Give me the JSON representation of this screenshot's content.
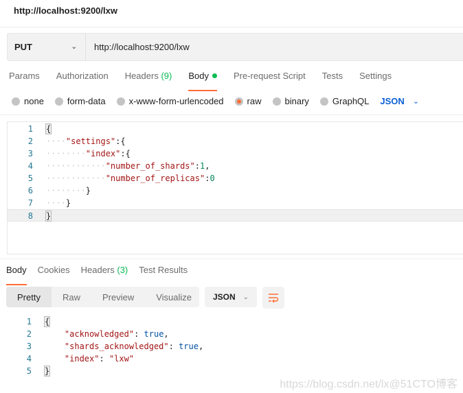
{
  "window": {
    "title": "http://localhost:9200/lxw"
  },
  "request": {
    "method": "PUT",
    "url": "http://localhost:9200/lxw"
  },
  "request_tabs": [
    {
      "label": "Params"
    },
    {
      "label": "Authorization"
    },
    {
      "label": "Headers",
      "count": "(9)"
    },
    {
      "label": "Body",
      "active": true
    },
    {
      "label": "Pre-request Script"
    },
    {
      "label": "Tests"
    },
    {
      "label": "Settings"
    }
  ],
  "body_types": [
    {
      "label": "none"
    },
    {
      "label": "form-data"
    },
    {
      "label": "x-www-form-urlencoded"
    },
    {
      "label": "raw",
      "selected": true
    },
    {
      "label": "binary"
    },
    {
      "label": "GraphQL"
    }
  ],
  "body_format": "JSON",
  "request_body": [
    {
      "num": "1",
      "indent": "",
      "key": "",
      "rest": "{"
    },
    {
      "num": "2",
      "indent": "····",
      "key": "\"settings\"",
      "rest": ":{"
    },
    {
      "num": "3",
      "indent": "········",
      "key": "\"index\"",
      "rest": ":{"
    },
    {
      "num": "4",
      "indent": "············",
      "key": "\"number_of_shards\"",
      "rest": ":",
      "val": "1",
      "tail": ","
    },
    {
      "num": "5",
      "indent": "············",
      "key": "\"number_of_replicas\"",
      "rest": ":",
      "val": "0",
      "tail": ""
    },
    {
      "num": "6",
      "indent": "········",
      "key": "",
      "rest": "}"
    },
    {
      "num": "7",
      "indent": "····",
      "key": "",
      "rest": "}"
    },
    {
      "num": "8",
      "indent": "",
      "key": "",
      "rest": "}"
    }
  ],
  "response_tabs": [
    {
      "label": "Body",
      "active": true
    },
    {
      "label": "Cookies"
    },
    {
      "label": "Headers",
      "count": "(3)"
    },
    {
      "label": "Test Results"
    }
  ],
  "response_views": [
    "Pretty",
    "Raw",
    "Preview",
    "Visualize"
  ],
  "response_format": "JSON",
  "response_body": [
    {
      "num": "1",
      "key": "",
      "sep": "",
      "val": "{",
      "type": "p"
    },
    {
      "num": "2",
      "key": "\"acknowledged\"",
      "sep": ": ",
      "val": "true",
      "tail": ",",
      "type": "b"
    },
    {
      "num": "3",
      "key": "\"shards_acknowledged\"",
      "sep": ": ",
      "val": "true",
      "tail": ",",
      "type": "b"
    },
    {
      "num": "4",
      "key": "\"index\"",
      "sep": ": ",
      "val": "\"lxw\"",
      "tail": "",
      "type": "k"
    },
    {
      "num": "5",
      "key": "",
      "sep": "",
      "val": "}",
      "type": "p"
    }
  ],
  "watermark": "https://blog.csdn.net/lx@51CTO博客",
  "colors": {
    "accent": "#ff6c37",
    "green": "#0cbb52",
    "link": "#0b5fd4"
  }
}
